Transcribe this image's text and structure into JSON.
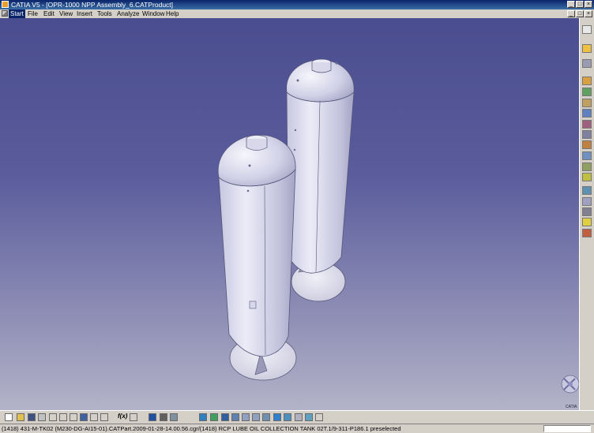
{
  "window": {
    "title": "CATIA V5 - [OPR-1000 NPP Assembly_6.CATProduct]",
    "minimize_glyph": "_",
    "maximize_glyph": "□",
    "close_glyph": "×"
  },
  "menubar": {
    "items": [
      "Start",
      "File",
      "Edit",
      "View",
      "Insert",
      "Tools",
      "Analyze",
      "Window",
      "Help"
    ],
    "active": "Start"
  },
  "status": {
    "text": "(1418) 431-M-TK02 (M230-DG-AI15-01).CATPart.2009-01-28-14.00.56.cgr/(1418) RCP LUBE OIL COLLECTION TANK 02T.1/9-311-P186.1 preselected"
  },
  "toolbar": {
    "fx_label": "f(x)"
  },
  "compass": {
    "brand": "CATIA"
  },
  "colors": {
    "titlebar": "#0a246a",
    "viewport_top": "#4a4d8f",
    "viewport_bottom": "#b3b3c8",
    "part_light": "#e4e4f2",
    "part_dark": "#a9a9c8"
  }
}
